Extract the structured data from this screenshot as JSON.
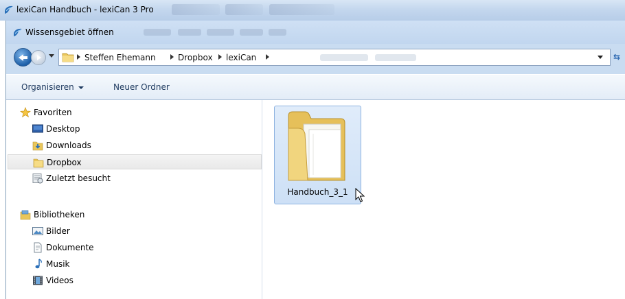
{
  "background_window": {
    "title": "lexiCan Handbuch - lexiCan 3 Pro"
  },
  "dialog": {
    "title": "Wissensgebiet öffnen",
    "breadcrumb": [
      "Steffen Ehemann",
      "Dropbox",
      "lexiCan"
    ],
    "toolbar": {
      "organize_label": "Organisieren",
      "new_folder_label": "Neuer Ordner"
    }
  },
  "nav_pane": {
    "favorites": {
      "header": "Favoriten",
      "items": [
        {
          "label": "Desktop",
          "icon": "desktop-icon"
        },
        {
          "label": "Downloads",
          "icon": "downloads-folder-icon"
        },
        {
          "label": "Dropbox",
          "icon": "dropbox-folder-icon",
          "selected": true
        },
        {
          "label": "Zuletzt besucht",
          "icon": "recent-places-icon"
        }
      ]
    },
    "libraries": {
      "header": "Bibliotheken",
      "items": [
        {
          "label": "Bilder",
          "icon": "pictures-icon"
        },
        {
          "label": "Dokumente",
          "icon": "documents-icon"
        },
        {
          "label": "Musik",
          "icon": "music-icon"
        },
        {
          "label": "Videos",
          "icon": "videos-icon"
        }
      ]
    }
  },
  "content": {
    "items": [
      {
        "name": "Handbuch_3_1",
        "type": "folder",
        "selected": true
      }
    ]
  },
  "colors": {
    "selection_fill": "#cde0f6",
    "selection_border": "#8db2e0",
    "title_bar": "#c4d7ee"
  }
}
